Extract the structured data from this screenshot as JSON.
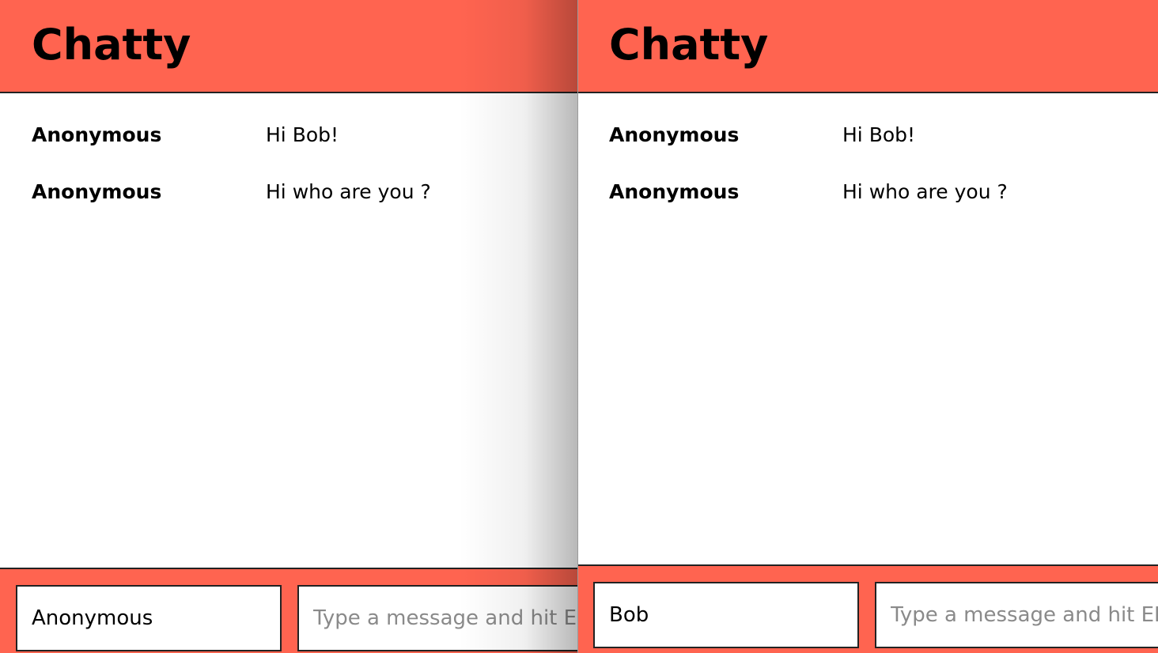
{
  "theme": {
    "accent": "#ff6450",
    "text": "#000000",
    "border": "#222222",
    "placeholder_color": "#8a8a8a"
  },
  "windows": [
    {
      "app_title": "Chatty",
      "messages": [
        {
          "username": "Anonymous",
          "content": "Hi Bob!"
        },
        {
          "username": "Anonymous",
          "content": "Hi who are you ?"
        }
      ],
      "chatbar": {
        "username_value": "Anonymous",
        "message_value": "",
        "message_placeholder": "Type a message and hit ENTER"
      }
    },
    {
      "app_title": "Chatty",
      "messages": [
        {
          "username": "Anonymous",
          "content": "Hi Bob!"
        },
        {
          "username": "Anonymous",
          "content": "Hi who are you ?"
        }
      ],
      "chatbar": {
        "username_value": "Bob",
        "message_value": "",
        "message_placeholder": "Type a message and hit ENTER"
      }
    }
  ]
}
